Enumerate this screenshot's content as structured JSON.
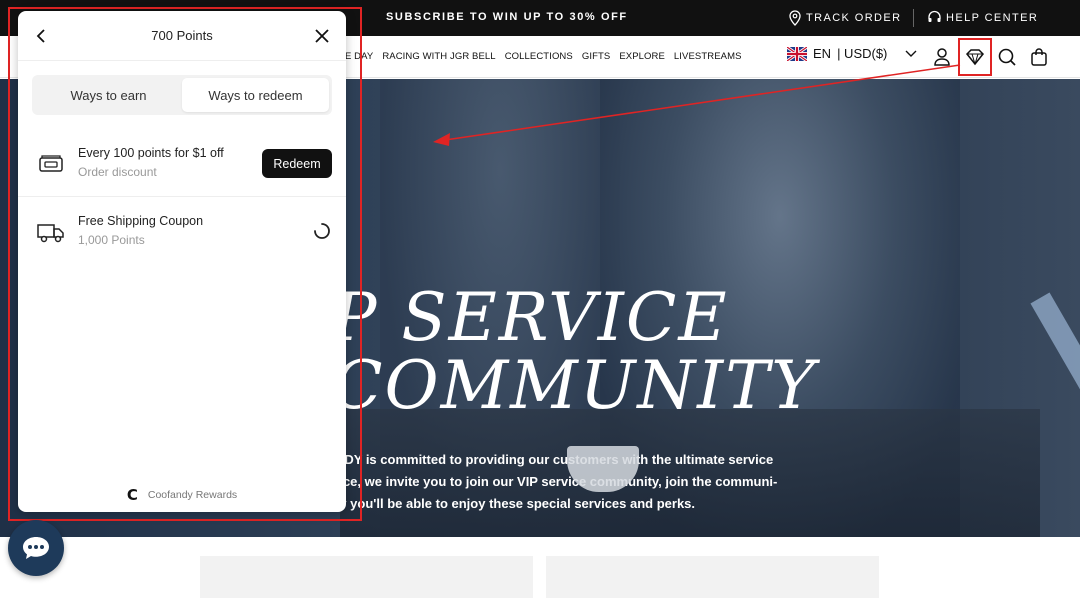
{
  "topbar": {
    "promo": "SUBSCRIBE TO WIN UP TO 30% OFF",
    "track_order": "TRACK ORDER",
    "help_center": "HELP CENTER"
  },
  "nav": {
    "menu": [
      "E DAY",
      "RACING WITH JGR BELL",
      "COLLECTIONS",
      "GIFTS",
      "EXPLORE",
      "LIVESTREAMS"
    ],
    "language": "EN",
    "currency": "| USD($)"
  },
  "hero": {
    "title_line1": "P SERVICE",
    "title_line2": "COMMUNITY",
    "desc_line1": "NDY is committed to providing our customers with the ultimate service",
    "desc_line2": "nce, we invite you to join our VIP service community, join the communi-",
    "desc_line3": "ty you'll be able to enjoy these special services and perks."
  },
  "panel": {
    "title": "700 Points",
    "tabs": [
      {
        "label": "Ways to earn",
        "active": false
      },
      {
        "label": "Ways to redeem",
        "active": true
      }
    ],
    "rewards": [
      {
        "name": "Every 100 points for $1 off",
        "sub": "Order discount",
        "action": "Redeem",
        "icon": "coupon-icon"
      },
      {
        "name": "Free Shipping Coupon",
        "sub": "1,000 Points",
        "action": "loading",
        "icon": "truck-icon"
      }
    ],
    "footer_logo": "C",
    "footer_text": "Coofandy Rewards"
  },
  "colors": {
    "accent": "#111111",
    "highlight": "#e02424",
    "chat": "#1e3a5a"
  }
}
